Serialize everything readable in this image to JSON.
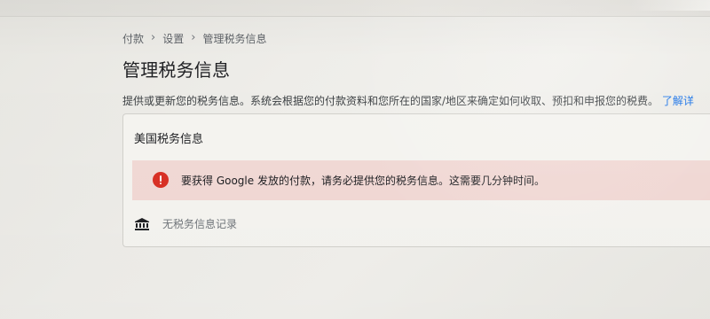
{
  "breadcrumb": {
    "items": [
      "付款",
      "设置",
      "管理税务信息"
    ],
    "separator": "›"
  },
  "page": {
    "title": "管理税务信息",
    "description": "提供或更新您的税务信息。系统会根据您的付款资料和您所在的国家/地区来确定如何收取、预扣和申报您的税费。",
    "learn_more": "了解详"
  },
  "card": {
    "title": "美国税务信息",
    "alert_text": "要获得 Google 发放的付款，请务必提供您的税务信息。这需要几分钟时间。",
    "empty_text": "无税务信息记录"
  },
  "icons": {
    "alert": "error-icon",
    "empty_state": "bank-icon"
  },
  "colors": {
    "accent": "#1a73e8",
    "error": "#d93025",
    "alert_bg": "#f2d9d5"
  }
}
